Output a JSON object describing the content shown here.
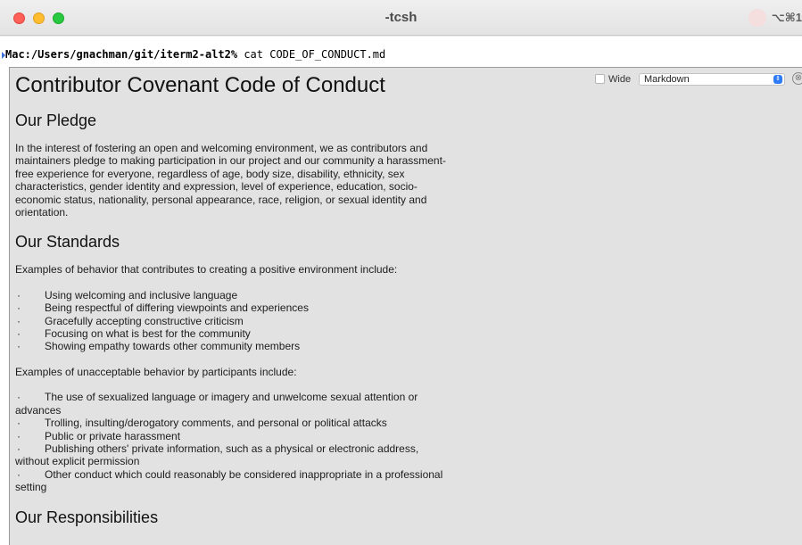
{
  "window": {
    "title": "-tcsh",
    "tab_shortcut": "⌥⌘1"
  },
  "terminal": {
    "prompt_path": "Mac:/Users/gnachman/git/iterm2-alt2%",
    "command": " cat CODE_OF_CONDUCT.md"
  },
  "controls": {
    "wide_label": "Wide",
    "wide_checked": false,
    "format_selected": "Markdown",
    "close_icon": "⊗"
  },
  "document": {
    "h1": "Contributor Covenant Code of Conduct",
    "pledge_heading": "Our Pledge",
    "pledge_text": "In the interest of fostering an open and welcoming environment, we as contributors and maintainers pledge to making participation in our project and our community a harassment-free experience for everyone, regardless of age, body size, disability, ethnicity, sex characteristics, gender identity and expression, level of experience, education, socio-economic status, nationality, personal appearance, race, religion, or sexual identity and orientation.",
    "standards_heading": "Our Standards",
    "standards_intro": "Examples of behavior that contributes to creating a positive environment include:",
    "positive_items": [
      "Using welcoming and inclusive language",
      "Being respectful of differing viewpoints and experiences",
      "Gracefully accepting constructive criticism",
      "Focusing on what is best for the community",
      "Showing empathy towards other community members"
    ],
    "unacceptable_intro": "Examples of unacceptable behavior by participants include:",
    "negative_items": [
      "The use of sexualized language or imagery and unwelcome sexual attention or advances",
      "Trolling, insulting/derogatory comments, and personal or political attacks",
      "Public or private harassment",
      "Publishing others' private information, such as a physical or electronic address, without explicit permission",
      "Other conduct which could reasonably be considered inappropriate in a professional setting"
    ],
    "responsibilities_heading": "Our Responsibilities",
    "bullet": "·"
  }
}
